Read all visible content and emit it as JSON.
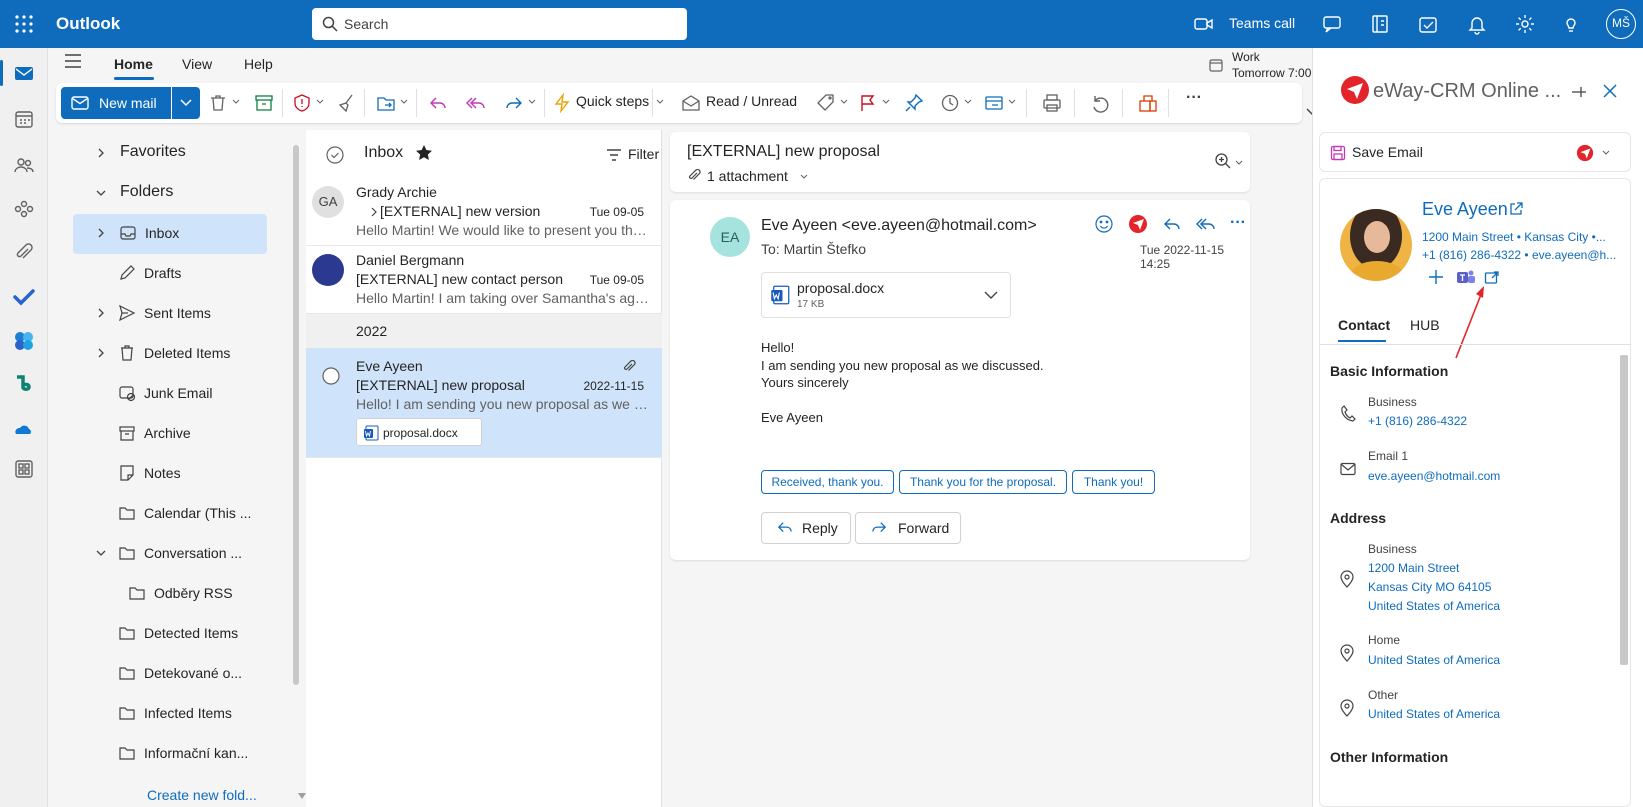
{
  "app": {
    "name": "Outlook"
  },
  "search": {
    "placeholder": "Search"
  },
  "topbar": {
    "teams_call_label": "Teams call",
    "avatar_initials": "MŠ"
  },
  "ribbon": {
    "tabs": [
      "Home",
      "View",
      "Help"
    ],
    "new_mail_label": "New mail",
    "quick_steps_label": "Quick steps",
    "read_unread_label": "Read / Unread",
    "more_label": "···"
  },
  "work": {
    "label": "Work",
    "subtitle": "Tomorrow 7:00"
  },
  "folders": {
    "favorites_label": "Favorites",
    "folders_label": "Folders",
    "items": [
      {
        "label": "Inbox"
      },
      {
        "label": "Drafts"
      },
      {
        "label": "Sent Items"
      },
      {
        "label": "Deleted Items"
      },
      {
        "label": "Junk Email"
      },
      {
        "label": "Archive"
      },
      {
        "label": "Notes"
      },
      {
        "label": "Calendar (This ..."
      },
      {
        "label": "Conversation ..."
      },
      {
        "label": "Odběry RSS"
      },
      {
        "label": "Detected Items"
      },
      {
        "label": "Detekované o..."
      },
      {
        "label": "Infected Items"
      },
      {
        "label": "Informační kan..."
      }
    ],
    "create_new_label": "Create new fold..."
  },
  "list": {
    "title": "Inbox",
    "filter_label": "Filter",
    "group_label": "2022",
    "messages": [
      {
        "initials": "GA",
        "from": "Grady Archie",
        "subject": "[EXTERNAL] new version",
        "date": "Tue 09-05",
        "preview": "Hello Martin! We would like to present you the ..."
      },
      {
        "initials": "",
        "from": "Daniel Bergmann",
        "subject": "[EXTERNAL] new contact person",
        "date": "Tue 09-05",
        "preview": "Hello Martin! I am taking over Samantha's agen..."
      },
      {
        "initials": "",
        "from": "Eve Ayeen",
        "subject": "[EXTERNAL] new proposal",
        "date": "2022-11-15",
        "preview": "Hello! I am sending you new proposal as we dis...",
        "attachment": "proposal.docx"
      }
    ]
  },
  "reading": {
    "subject": "[EXTERNAL] new proposal",
    "attachments_label": "1 attachment",
    "sender_initials": "EA",
    "sender": "Eve Ayeen <eve.ayeen@hotmail.com>",
    "to": "To:  Martin Štefko",
    "date": "Tue 2022-11-15 14:25",
    "attachment_name": "proposal.docx",
    "attachment_size": "17 KB",
    "body": [
      "Hello!",
      "I am sending you new proposal as we discussed.",
      "Yours sincerely",
      "",
      "Eve Ayeen"
    ],
    "quick_replies": [
      "Received, thank you.",
      "Thank you for the proposal.",
      "Thank you!"
    ],
    "reply_label": "Reply",
    "forward_label": "Forward"
  },
  "crm": {
    "title": "eWay-CRM Online ...",
    "save_email_label": "Save Email",
    "contact_name": "Eve Ayeen",
    "address_line": "1200 Main Street  •  Kansas City  •...",
    "phone_email_line": "+1 (816) 286-4322  •  eve.ayeen@h...",
    "tabs": [
      "Contact",
      "HUB"
    ],
    "basic_info_label": "Basic Information",
    "business_label": "Business",
    "business_phone": "+1 (816) 286-4322",
    "email_label": "Email 1",
    "email": "eve.ayeen@hotmail.com",
    "address_label": "Address",
    "addr_business_label": "Business",
    "addr_business_lines": [
      "1200 Main Street",
      "Kansas City MO 64105",
      "United States of America"
    ],
    "addr_home_label": "Home",
    "addr_home": "United States of America",
    "addr_other_label": "Other",
    "addr_other": "United States of America",
    "other_info_label": "Other Information"
  },
  "colors": {
    "brand": "#0f6cbd",
    "selected": "#cfe4fa",
    "crm_red": "#e3242b"
  }
}
